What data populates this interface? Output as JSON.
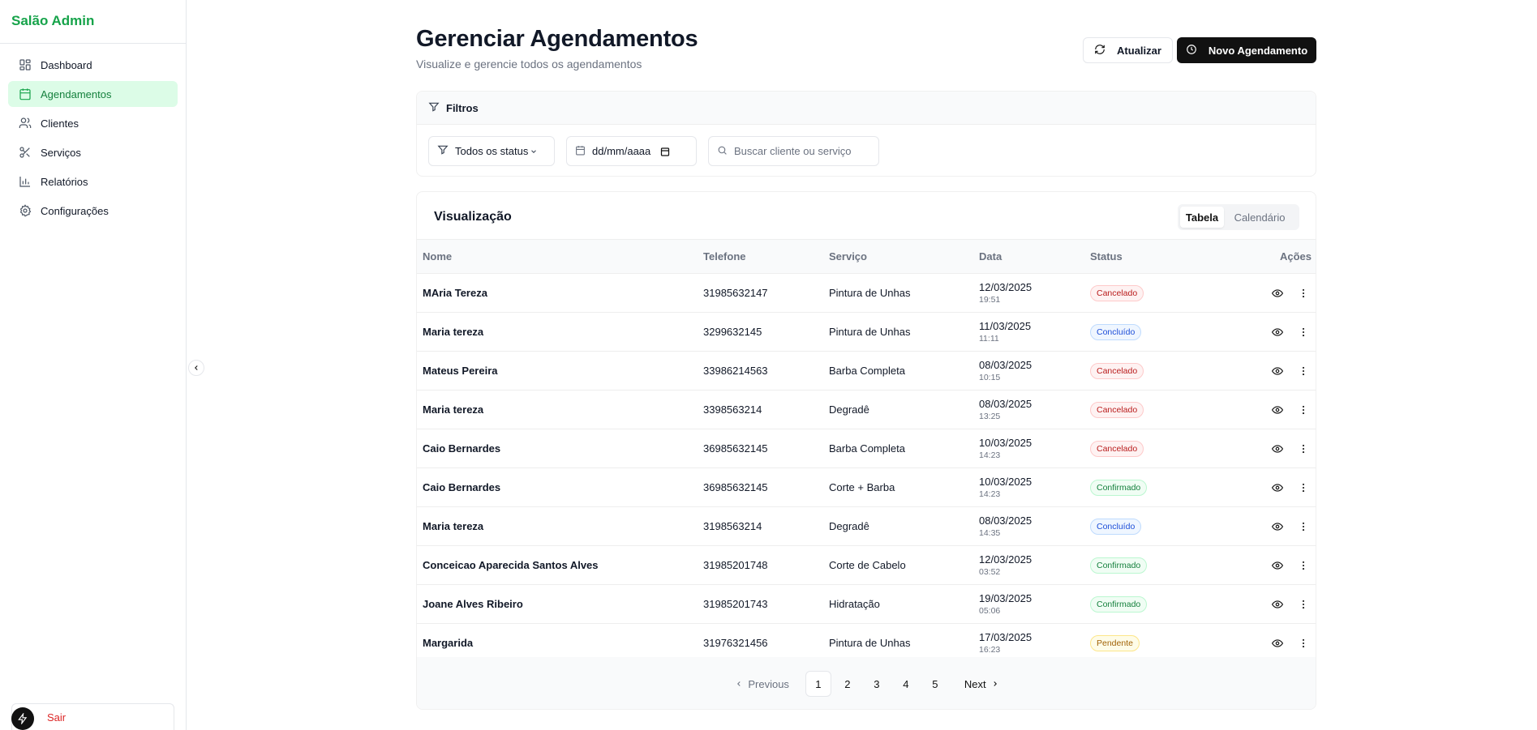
{
  "app": {
    "brand": "Salão Admin",
    "logout_label": "Sair"
  },
  "sidebar": {
    "items": [
      {
        "label": "Dashboard",
        "icon": "dashboard-icon",
        "active": false
      },
      {
        "label": "Agendamentos",
        "icon": "calendar-icon",
        "active": true
      },
      {
        "label": "Clientes",
        "icon": "users-icon",
        "active": false
      },
      {
        "label": "Serviços",
        "icon": "scissors-icon",
        "active": false
      },
      {
        "label": "Relatórios",
        "icon": "bar-chart-icon",
        "active": false
      },
      {
        "label": "Configurações",
        "icon": "gear-icon",
        "active": false
      }
    ]
  },
  "header": {
    "title": "Gerenciar Agendamentos",
    "subtitle": "Visualize e gerencie todos os agendamentos",
    "refresh_label": "Atualizar",
    "new_label": "Novo Agendamento"
  },
  "filters": {
    "title": "Filtros",
    "status_value": "Todos os status",
    "date_placeholder": "dd/mm/aaaa",
    "search_placeholder": "Buscar cliente ou serviço"
  },
  "view": {
    "title": "Visualização",
    "tab_table": "Tabela",
    "tab_calendar": "Calendário"
  },
  "table": {
    "columns": [
      "Nome",
      "Telefone",
      "Serviço",
      "Data",
      "Status",
      "Ações"
    ],
    "rows": [
      {
        "name": "MAria Tereza",
        "phone": "31985632147",
        "service": "Pintura de Unhas",
        "date": "12/03/2025",
        "time": "19:51",
        "status": "Cancelado"
      },
      {
        "name": "Maria tereza",
        "phone": "3299632145",
        "service": "Pintura de Unhas",
        "date": "11/03/2025",
        "time": "11:11",
        "status": "Concluído"
      },
      {
        "name": "Mateus Pereira",
        "phone": "33986214563",
        "service": "Barba Completa",
        "date": "08/03/2025",
        "time": "10:15",
        "status": "Cancelado"
      },
      {
        "name": "Maria tereza",
        "phone": "3398563214",
        "service": "Degradê",
        "date": "08/03/2025",
        "time": "13:25",
        "status": "Cancelado"
      },
      {
        "name": "Caio Bernardes",
        "phone": "36985632145",
        "service": "Barba Completa",
        "date": "10/03/2025",
        "time": "14:23",
        "status": "Cancelado"
      },
      {
        "name": "Caio Bernardes",
        "phone": "36985632145",
        "service": "Corte + Barba",
        "date": "10/03/2025",
        "time": "14:23",
        "status": "Confirmado"
      },
      {
        "name": "Maria tereza",
        "phone": "3198563214",
        "service": "Degradê",
        "date": "08/03/2025",
        "time": "14:35",
        "status": "Concluído"
      },
      {
        "name": "Conceicao Aparecida Santos Alves",
        "phone": "31985201748",
        "service": "Corte de Cabelo",
        "date": "12/03/2025",
        "time": "03:52",
        "status": "Confirmado"
      },
      {
        "name": "Joane Alves Ribeiro",
        "phone": "31985201743",
        "service": "Hidratação",
        "date": "19/03/2025",
        "time": "05:06",
        "status": "Confirmado"
      },
      {
        "name": "Margarida",
        "phone": "31976321456",
        "service": "Pintura de Unhas",
        "date": "17/03/2025",
        "time": "16:23",
        "status": "Pendente"
      }
    ]
  },
  "status_colors": {
    "Cancelado": {
      "fg": "#b91c1c",
      "bg": "#fef2f2",
      "border": "#fecaca"
    },
    "Concluído": {
      "fg": "#1d4ed8",
      "bg": "#eff6ff",
      "border": "#bfdbfe"
    },
    "Confirmado": {
      "fg": "#15803d",
      "bg": "#f0fdf4",
      "border": "#bbf7d0"
    },
    "Pendente": {
      "fg": "#a16207",
      "bg": "#fefce8",
      "border": "#fde68a"
    }
  },
  "pagination": {
    "previous_label": "Previous",
    "next_label": "Next",
    "pages": [
      "1",
      "2",
      "3",
      "4",
      "5"
    ],
    "current": "1"
  },
  "colors": {
    "accent": "#16a34a",
    "accent_bg": "#dcfce7",
    "primary_button": "#111111"
  }
}
